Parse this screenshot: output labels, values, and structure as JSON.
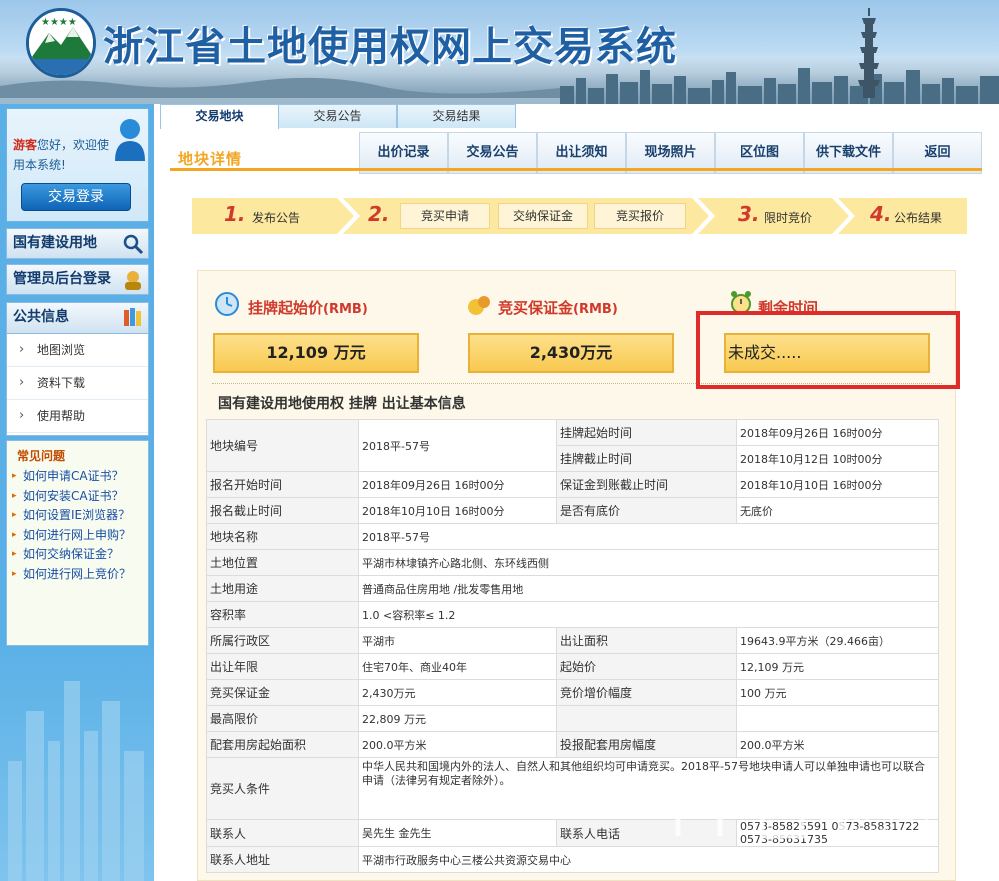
{
  "header": {
    "site_title": "浙江省土地使用权网上交易系统"
  },
  "sidebar": {
    "welcome_guest": "游客",
    "welcome_text": "您好，欢迎使用本系统!",
    "login_button": "交易登录",
    "menu_land": "国有建设用地",
    "menu_admin": "管理员后台登录",
    "public_info_title": "公共信息",
    "public_items": [
      "地图浏览",
      "资料下载",
      "使用帮助"
    ],
    "faq_title": "常见问题",
    "faq_items": [
      "如何申请CA证书？",
      "如何安装CA证书？",
      "如何设置IE浏览器？",
      "如何进行网上申购？",
      "如何交纳保证金？",
      "如何进行网上竞价？"
    ]
  },
  "tabs": [
    "交易地块",
    "交易公告",
    "交易结果"
  ],
  "subnav": {
    "title": "地块详情",
    "buttons": [
      "出价记录",
      "交易公告",
      "出让须知",
      "现场照片",
      "区位图",
      "供下载文件",
      "返回"
    ]
  },
  "steps": {
    "s1_num": "1.",
    "s1_label": "发布公告",
    "s2_num": "2.",
    "s2_chips": [
      "竞买申请",
      "交纳保证金",
      "竞买报价"
    ],
    "s3_num": "3.",
    "s3_label": "限时竞价",
    "s4_num": "4.",
    "s4_label": "公布结果"
  },
  "metrics": {
    "start_price_label": "挂牌起始价",
    "start_price_unit": "(RMB)",
    "start_price_value": "12,109 万元",
    "deposit_label": "竞买保证金",
    "deposit_unit": "(RMB)",
    "deposit_value": "2,430万元",
    "remaining_label": "剩余时间",
    "remaining_value": "未成交....."
  },
  "section_title": "国有建设用地使用权 挂牌 出让基本信息",
  "table": {
    "plot_no_k": "地块编号",
    "plot_no_v": "2018平-57号",
    "listing_start_k": "挂牌起始时间",
    "listing_start_v": "2018年09月26日 16时00分",
    "listing_end_k": "挂牌截止时间",
    "listing_end_v": "2018年10月12日 10时00分",
    "reg_start_k": "报名开始时间",
    "reg_start_v": "2018年09月26日 16时00分",
    "deposit_deadline_k": "保证金到账截止时间",
    "deposit_deadline_v": "2018年10月10日 16时00分",
    "reg_end_k": "报名截止时间",
    "reg_end_v": "2018年10月10日 16时00分",
    "reserve_k": "是否有底价",
    "reserve_v": "无底价",
    "name_k": "地块名称",
    "name_v": "2018平-57号",
    "location_k": "土地位置",
    "location_v": "平湖市林埭镇齐心路北侧、东环线西侧",
    "use_k": "土地用途",
    "use_v": "普通商品住房用地 /批发零售用地",
    "far_k": "容积率",
    "far_v": "1.0 <容积率≤ 1.2",
    "district_k": "所属行政区",
    "district_v": "平湖市",
    "area_k": "出让面积",
    "area_v": "19643.9平方米（29.466亩）",
    "term_k": "出让年限",
    "term_v": "住宅70年、商业40年",
    "start_price_k": "起始价",
    "start_price_v": "12,109 万元",
    "bid_deposit_k": "竞买保证金",
    "bid_deposit_v": "2,430万元",
    "increment_k": "竞价增价幅度",
    "increment_v": "100 万元",
    "max_price_k": "最高限价",
    "max_price_v": "22,809 万元",
    "housing_area_k": "配套用房起始面积",
    "housing_area_v": "200.0平方米",
    "housing_inc_k": "投报配套用房幅度",
    "housing_inc_v": "200.0平方米",
    "conditions_k": "竞买人条件",
    "conditions_v": "中华人民共和国境内外的法人、自然人和其他组织均可申请竞买。2018平-57号地块申请人可以单独申请也可以联合申请（法律另有规定者除外）。",
    "contact_k": "联系人",
    "contact_v": "吴先生 金先生",
    "phone_k": "联系人电话",
    "phone_v": "0573-85825591 0573-85831722 0573-85631735",
    "address_k": "联系人地址",
    "address_v": "平湖市行政服务中心三楼公共资源交易中心"
  },
  "watermark": {
    "text": "房产超市",
    "url": "fccs.com"
  }
}
